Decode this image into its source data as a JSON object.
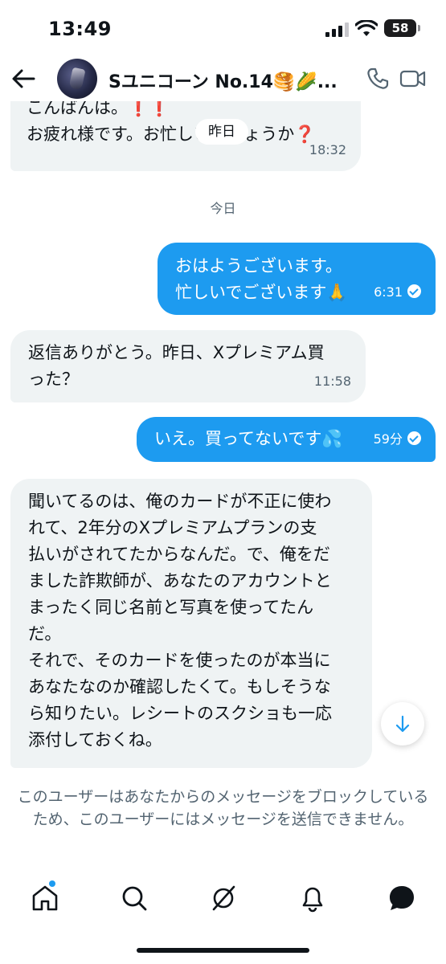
{
  "status_bar": {
    "time": "13:49",
    "battery": "58"
  },
  "header": {
    "contact_name": "Sユニコーン No.14🥞🌽...",
    "icons": [
      "back-arrow-icon",
      "avatar",
      "phone-icon",
      "video-icon"
    ]
  },
  "messages": [
    {
      "direction": "incoming",
      "lines": [
        "こんばんは。❗❗",
        "お疲れ様です。お忙しいでしょうか❓"
      ],
      "time": "18:32"
    },
    {
      "direction": "outgoing",
      "lines": [
        "おはようございます。",
        "忙しいでございます🙏"
      ],
      "time": "6:31"
    },
    {
      "direction": "incoming",
      "lines": [
        "返信ありがとう。昨日、Xプレミアム買",
        "った？"
      ],
      "time": "11:58"
    },
    {
      "direction": "outgoing",
      "lines": [
        "いえ。買ってないです💦"
      ],
      "time": "59分"
    },
    {
      "direction": "incoming",
      "lines": [
        "聞いてるのは、俺のカードが不正に使わ",
        "れて、2年分のXプレミアムプランの支",
        "払いがされてたからなんだ。で、俺をだ",
        "ました詐欺師が、あなたのアカウントと",
        "まったく同じ名前と写真を使ってたん",
        "だ。",
        "それで、そのカードを使ったのが本当に",
        "あなたなのか確認したくて。もしそうな",
        "ら知りたい。レシートのスクショも一応",
        "添付しておくね。"
      ]
    }
  ],
  "date_chip_yesterday": "昨日",
  "date_divider_today": "今日",
  "blocked_notice": "このユーザーはあなたからのメッセージをブロックしているため、このユーザーにはメッセージを送信できません。",
  "colors": {
    "accent": "#1d9bf0",
    "incoming_bubble": "#eff3f4",
    "muted_text": "#536471"
  },
  "bottom_nav": [
    "home-icon",
    "search-icon",
    "grok-icon",
    "notifications-icon",
    "messages-icon"
  ]
}
